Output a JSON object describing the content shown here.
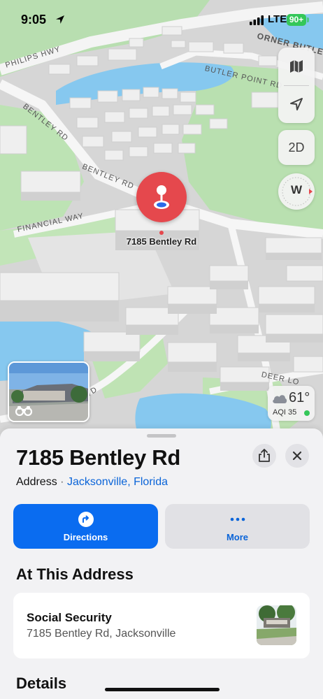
{
  "status_bar": {
    "time": "9:05",
    "network": "LTE",
    "battery": "90+"
  },
  "map": {
    "road_labels": [
      "PHILIPS HWY",
      "BENTLEY RD",
      "BENTLEY RD",
      "BUTLER POINT RD",
      "FINANCIAL WAY",
      "DEER LO",
      "ORNER BUTLE",
      "HN'S BLVD"
    ],
    "pin_label": "7185 Bentley Rd",
    "controls": {
      "map_mode_icon": "map-icon",
      "locate_icon": "location-arrow-icon",
      "view_toggle": "2D",
      "compass_heading": "W"
    },
    "weather": {
      "temperature": "61°",
      "aqi": "AQI 35",
      "icon": "cloud-icon",
      "aqi_color": "#34c759"
    }
  },
  "place": {
    "title": "7185 Bentley Rd",
    "type": "Address",
    "separator": "·",
    "location": "Jacksonville, Florida",
    "share_icon": "share-icon",
    "close_icon": "close-icon"
  },
  "actions": [
    {
      "label": "Directions",
      "icon": "directions-icon",
      "color": "#0a6cf0"
    },
    {
      "label": "More",
      "icon": "ellipsis-icon",
      "color": "#0a64d8"
    }
  ],
  "at_address": {
    "title": "At This Address",
    "items": [
      {
        "name": "Social Security",
        "address": "7185 Bentley Rd, Jacksonville"
      }
    ]
  },
  "details": {
    "title": "Details"
  }
}
